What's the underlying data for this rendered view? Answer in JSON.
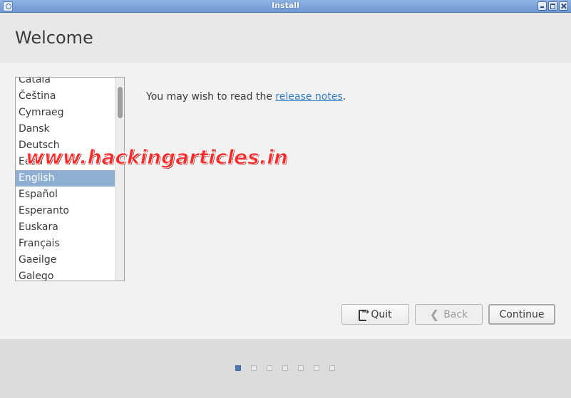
{
  "window": {
    "title": "Install"
  },
  "header": {
    "title": "Welcome"
  },
  "languages": {
    "items": [
      {
        "label": "Català"
      },
      {
        "label": "Čeština"
      },
      {
        "label": "Cymraeg"
      },
      {
        "label": "Dansk"
      },
      {
        "label": "Deutsch"
      },
      {
        "label": "Eesti"
      },
      {
        "label": "English"
      },
      {
        "label": "Español"
      },
      {
        "label": "Esperanto"
      },
      {
        "label": "Euskara"
      },
      {
        "label": "Français"
      },
      {
        "label": "Gaeilge"
      },
      {
        "label": "Galego"
      }
    ],
    "selected": "English"
  },
  "main": {
    "release_prefix": "You may wish to read the ",
    "release_link": "release notes",
    "release_suffix": "."
  },
  "watermark": "www.hackingarticles.in",
  "buttons": {
    "quit": "Quit",
    "back": "Back",
    "continue": "Continue"
  },
  "progress": {
    "total_steps": 7,
    "current_step": 1
  },
  "icons": {
    "app": "installer-icon",
    "quit": "exit-door-icon",
    "back": "chevron-left-icon"
  },
  "colors": {
    "titlebar": "#7aa3db",
    "selection": "#8eaed2",
    "link": "#2e7bc4",
    "active_dot": "#4d78b0"
  }
}
